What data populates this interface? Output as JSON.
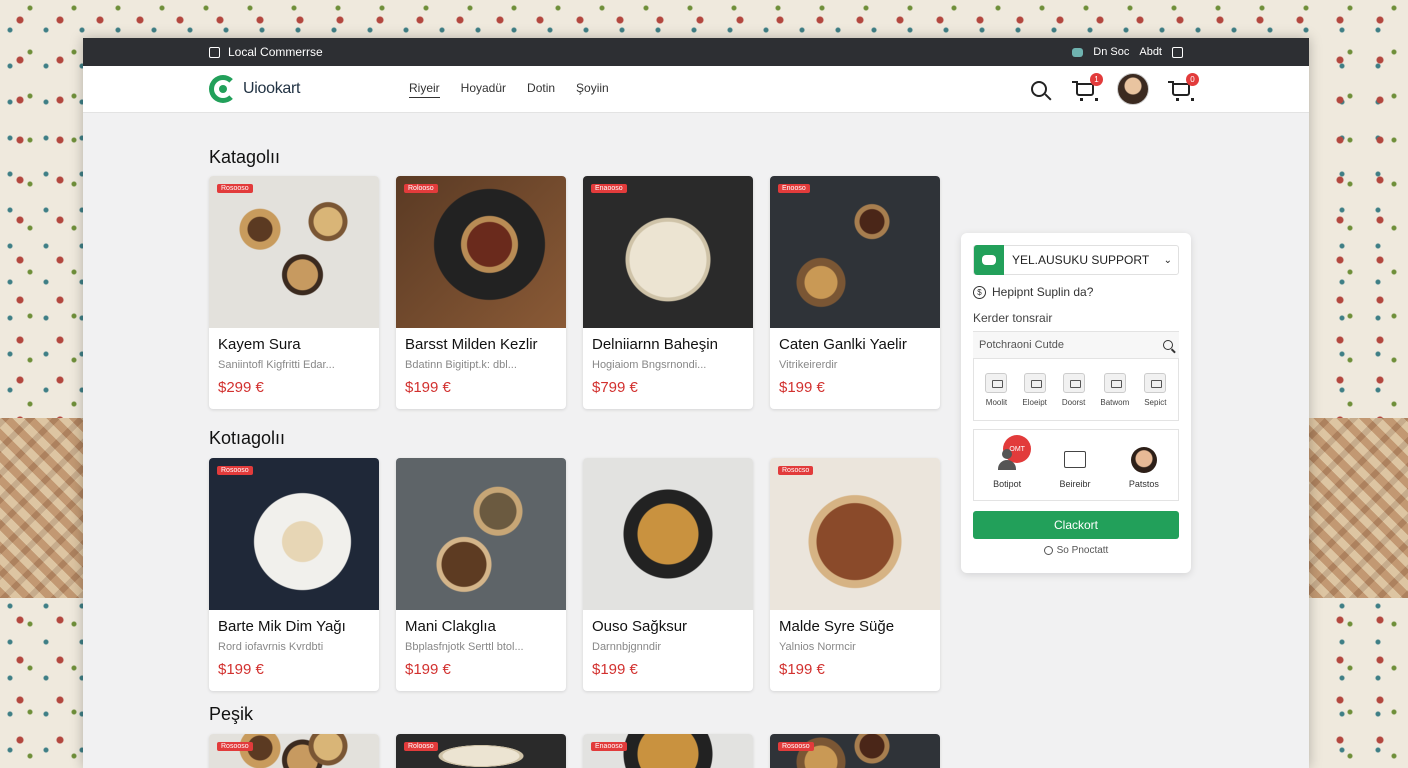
{
  "topbar": {
    "store_name": "Local Commerrse",
    "right_items": [
      "Dn Soc",
      "Abdt"
    ]
  },
  "navbar": {
    "logo_text": "Uiookart",
    "links": [
      "Riyeir",
      "Hoyadür",
      "Dotin",
      "Şoyiin"
    ],
    "cart_badge": "1",
    "cart2_badge": "0"
  },
  "sections": [
    {
      "title": "Katagolıı",
      "products": [
        {
          "tag": "Rosooso",
          "name": "Kayem Sura",
          "subtitle": "Saniintofl Kigfritti Edar...",
          "price": "$299 €",
          "photo": "warm-light"
        },
        {
          "tag": "Rolooso",
          "name": "Barsst Milden Kezlir",
          "subtitle": "Bdatinn Bigitipt.k: dbl...",
          "price": "$199 €",
          "photo": "wood-dark"
        },
        {
          "tag": "Enaooso",
          "name": "Delniiarnn Baheşin",
          "subtitle": "Hogiaiom Bngsrnondi...",
          "price": "$799 €",
          "photo": "dark"
        },
        {
          "tag": "Enooso",
          "name": "Caten Ganlki Yaelir",
          "subtitle": "Vitrikeirerdir",
          "price": "$199 €",
          "photo": "slate"
        }
      ]
    },
    {
      "title": "Kotıagolıı",
      "products": [
        {
          "tag": "Rosooso",
          "name": "Barte Mik Dim Yağı",
          "subtitle": "Rord iofavrnis Kvrdbti",
          "price": "$199 €",
          "photo": "navy"
        },
        {
          "tag": "",
          "name": "Mani Clakglıa",
          "subtitle": "Bbplasfnjotk Serttl btol...",
          "price": "$199 €",
          "photo": "grey"
        },
        {
          "tag": "",
          "name": "Ouso Sağksur",
          "subtitle": "Darnnbjgnndir",
          "price": "$199 €",
          "photo": "light"
        },
        {
          "tag": "Rosocso",
          "name": "Malde Syre Süğe",
          "subtitle": "Yalnios Normcir",
          "price": "$199 €",
          "photo": "light-warm"
        }
      ]
    },
    {
      "title": "Peşik",
      "products": [
        {
          "tag": "Rosooso",
          "photo": "warm-light"
        },
        {
          "tag": "Rolooso",
          "photo": "dark"
        },
        {
          "tag": "Enaooso",
          "photo": "light"
        },
        {
          "tag": "Rosooso",
          "photo": "slate"
        }
      ]
    }
  ],
  "support": {
    "title": "YEL.AUSUKU SUPPORT",
    "question": "Hepipnt Suplin da?",
    "label": "Kerder tonsrair",
    "search_placeholder": "Potchraoni Cutde",
    "categories": [
      "Moolit",
      "Eloeipt",
      "Doorst",
      "Batwom",
      "Sepict"
    ],
    "agents": [
      {
        "label": "Botipot",
        "badge": "OMT",
        "icon": "person-icon"
      },
      {
        "label": "Beireibr",
        "icon": "screen-icon"
      },
      {
        "label": "Patstos",
        "icon": "agent-avatar"
      }
    ],
    "button": "Clackort",
    "footer": "So Pnoctatt"
  },
  "colors": {
    "accent_green": "#22a05a",
    "price_red": "#d2312f",
    "badge_red": "#e23b3b",
    "topbar": "#2d2f33"
  }
}
